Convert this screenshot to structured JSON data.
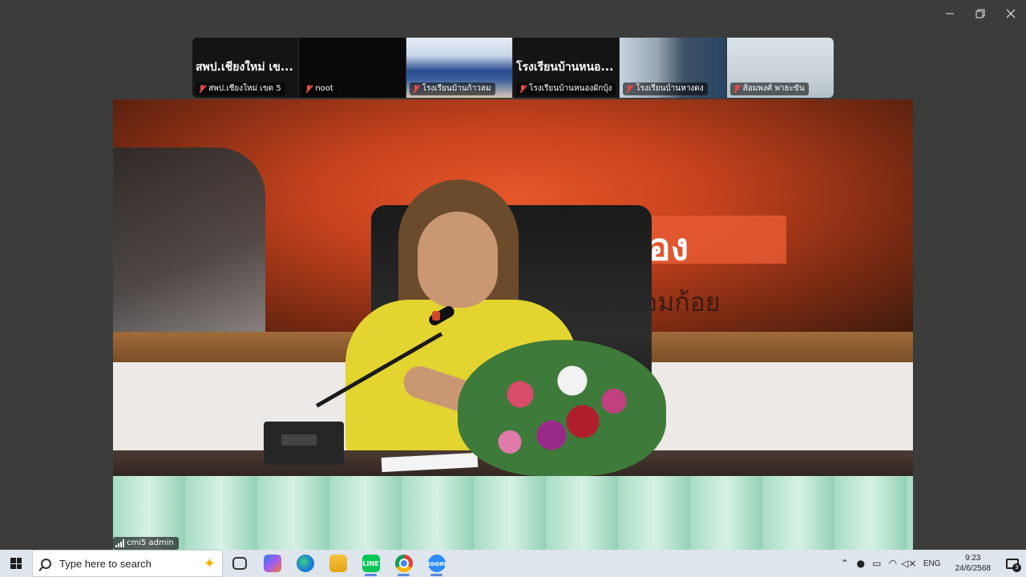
{
  "gallery": {
    "tiles": [
      {
        "big": "สพป.เชียงใหม่ เข...",
        "name": "สพป.เชียงใหม่ เขต 5"
      },
      {
        "big": "",
        "name": "noot"
      },
      {
        "big": "",
        "name": "โรงเรียนบ้านก้าวลม"
      },
      {
        "big": "โรงเรียนบ้านหนอ...",
        "name": "โรงเรียนบ้านหนองผักบุ้ง"
      },
      {
        "big": "",
        "name": "โรงเรียนบ้านหางดง"
      },
      {
        "big": "",
        "name": "ส้อมพงศ์ พาธะขัน"
      }
    ]
  },
  "main": {
    "sign_text": "อง",
    "sign_sub": "อมก้อย",
    "self_name": "cmi5 admin"
  },
  "taskbar": {
    "search_placeholder": "Type here to search",
    "lang": "ENG",
    "time": "9:23",
    "date": "24/6/2568",
    "notif_count": "3",
    "line_label": "LINE",
    "zoom_label": "zoom"
  },
  "icons": {
    "start": "windows-logo-icon",
    "search": "search-icon",
    "copilot": "copilot-icon",
    "edge": "edge-icon",
    "explorer": "folder-icon",
    "line": "line-icon",
    "chrome": "chrome-icon",
    "zoom": "zoom-icon"
  },
  "colors": {
    "mic_off": "#e54848",
    "taskbar": "#dfe5ec",
    "zoom_blue": "#2d8cff"
  }
}
